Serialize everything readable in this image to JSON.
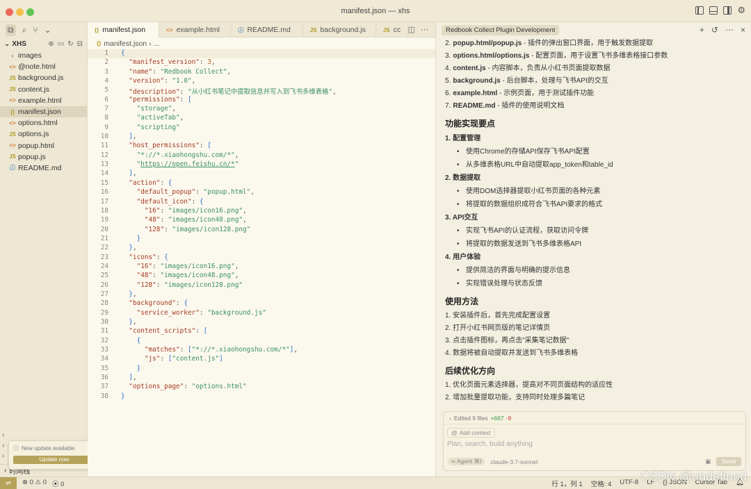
{
  "window": {
    "title": "manifest.json — xhs"
  },
  "sidebar": {
    "header": "XHS",
    "files": [
      {
        "name": "images",
        "type": "folder"
      },
      {
        "name": "@note.html",
        "type": "html"
      },
      {
        "name": "background.js",
        "type": "js"
      },
      {
        "name": "content.js",
        "type": "js"
      },
      {
        "name": "example.html",
        "type": "html"
      },
      {
        "name": "manifest.json",
        "type": "json",
        "selected": true
      },
      {
        "name": "options.html",
        "type": "html"
      },
      {
        "name": "options.js",
        "type": "js"
      },
      {
        "name": "popup.html",
        "type": "html"
      },
      {
        "name": "popup.js",
        "type": "js"
      },
      {
        "name": "README.md",
        "type": "info"
      }
    ],
    "timeline_label": "时间线"
  },
  "notification": {
    "text": "New update available",
    "button": "Update now"
  },
  "editor": {
    "tabs": [
      {
        "label": "manifest.json",
        "type": "json",
        "active": true
      },
      {
        "label": "example.html",
        "type": "html"
      },
      {
        "label": "README.md",
        "type": "info"
      },
      {
        "label": "background.js",
        "type": "js"
      },
      {
        "label": "cc",
        "type": "js"
      }
    ],
    "breadcrumb": [
      "manifest.json",
      "..."
    ],
    "lines": [
      "{",
      "  \"manifest_version\": 3,",
      "  \"name\": \"Redbook Collect\",",
      "  \"version\": \"1.0\",",
      "  \"description\": \"从小红书笔记中提取信息并写入到飞书多维表格\",",
      "  \"permissions\": [",
      "    \"storage\",",
      "    \"activeTab\",",
      "    \"scripting\"",
      "  ],",
      "  \"host_permissions\": [",
      "    \"*://*.xiaohongshu.com/*\",",
      "    \"https://open.feishu.cn/*\"",
      "  ],",
      "  \"action\": {",
      "    \"default_popup\": \"popup.html\",",
      "    \"default_icon\": {",
      "      \"16\": \"images/icon16.png\",",
      "      \"48\": \"images/icon48.png\",",
      "      \"128\": \"images/icon128.png\"",
      "    }",
      "  },",
      "  \"icons\": {",
      "    \"16\": \"images/icon16.png\",",
      "    \"48\": \"images/icon48.png\",",
      "    \"128\": \"images/icon128.png\"",
      "  },",
      "  \"background\": {",
      "    \"service_worker\": \"background.js\"",
      "  },",
      "  \"content_scripts\": [",
      "    {",
      "      \"matches\": [\"*://*.xiaohongshu.com/*\"],",
      "      \"js\": [\"content.js\"]",
      "    }",
      "  ],",
      "  \"options_page\": \"options.html\"",
      "}"
    ]
  },
  "panel": {
    "tab_title": "Redbook Collect Plugin Development",
    "file_list": [
      {
        "num": "2.",
        "file": "popup.html/popup.js",
        "desc": " - 插件的弹出窗口界面，用于触发数据提取"
      },
      {
        "num": "3.",
        "file": "options.html/options.js",
        "desc": " - 配置页面，用于设置飞书多维表格接口参数"
      },
      {
        "num": "4.",
        "file": "content.js",
        "desc": " - 内容脚本，负责从小红书页面提取数据"
      },
      {
        "num": "5.",
        "file": "background.js",
        "desc": " - 后台脚本，处理与飞书API的交互"
      },
      {
        "num": "6.",
        "file": "example.html",
        "desc": " - 示例页面，用于测试插件功能"
      },
      {
        "num": "7.",
        "file": "README.md",
        "desc": " - 插件的使用说明文档"
      }
    ],
    "features_heading": "功能实现要点",
    "features": [
      {
        "title": "1. 配置管理",
        "bullets": [
          "使用Chrome的存储API保存飞书API配置",
          "从多维表格URL中自动提取app_token和table_id"
        ]
      },
      {
        "title": "2. 数据提取",
        "bullets": [
          "使用DOM选择器提取小红书页面的各种元素",
          "将提取的数据组织成符合飞书API要求的格式"
        ]
      },
      {
        "title": "3. API交互",
        "bullets": [
          "实现飞书API的认证流程，获取访问令牌",
          "将提取的数据发送到飞书多维表格API"
        ]
      },
      {
        "title": "4. 用户体验",
        "bullets": [
          "提供简洁的界面与明确的提示信息",
          "实现错误处理与状态反馈"
        ]
      }
    ],
    "usage_heading": "使用方法",
    "usage": [
      "1. 安装插件后，首先完成配置设置",
      "2. 打开小红书网页版的笔记详情页",
      "3. 点击插件图标，再点击\"采集笔记数据\"",
      "4. 数据将被自动提取并发送到飞书多维表格"
    ],
    "optimize_heading": "后续优化方向",
    "optimize": [
      "1. 优化页面元素选择器，提高对不同页面结构的适应性",
      "2. 增加批量提取功能，支持同时处理多篇笔记"
    ],
    "chat": {
      "edited_label": "Edited 9 files",
      "added": "+667",
      "removed": "-9",
      "add_context": "Add context",
      "placeholder": "Plan, search, build anything",
      "agent_label": "Agent",
      "agent_shortcut": "⌘I",
      "model": "claude-3.7-sonnet",
      "send_label": "Send"
    }
  },
  "statusbar": {
    "errors": "0",
    "warnings": "0",
    "ports": "0",
    "position": "行 1，列 1",
    "spaces": "空格: 4",
    "encoding": "UTF-8",
    "eol": "LF",
    "language": "JSON",
    "cursor_tab": "Cursor Tab"
  },
  "watermark": "CSDN @undefined",
  "colors": {
    "accent": "#b6a35a",
    "background": "#f3efe1",
    "editor_bg": "#fbf8ee"
  }
}
